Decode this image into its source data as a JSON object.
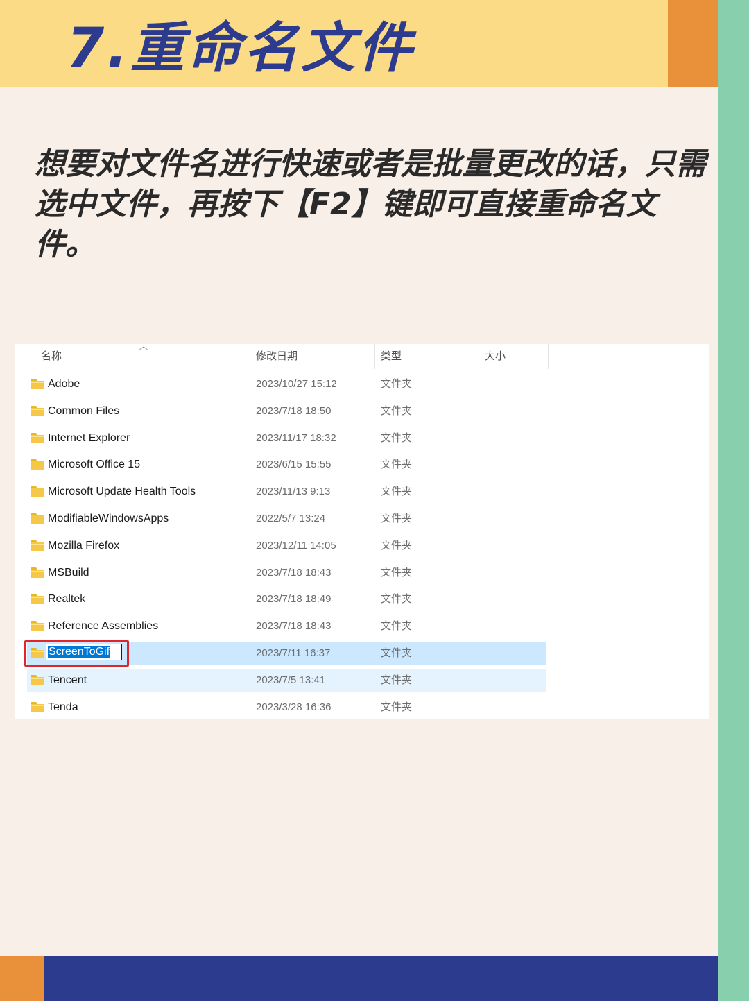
{
  "page": {
    "title": "7.重命名文件",
    "intro": "想要对文件名进行快速或者是批量更改的话，只需选中文件，再按下【F2】键即可直接重命名文件。"
  },
  "explorer": {
    "columns": {
      "name": "名称",
      "modified": "修改日期",
      "type": "类型",
      "size": "大小"
    },
    "rows": [
      {
        "name": "Adobe",
        "modified": "2023/10/27 15:12",
        "type": "文件夹"
      },
      {
        "name": "Common Files",
        "modified": "2023/7/18 18:50",
        "type": "文件夹"
      },
      {
        "name": "Internet Explorer",
        "modified": "2023/11/17 18:32",
        "type": "文件夹"
      },
      {
        "name": "Microsoft Office 15",
        "modified": "2023/6/15 15:55",
        "type": "文件夹"
      },
      {
        "name": "Microsoft Update Health Tools",
        "modified": "2023/11/13 9:13",
        "type": "文件夹"
      },
      {
        "name": "ModifiableWindowsApps",
        "modified": "2022/5/7 13:24",
        "type": "文件夹"
      },
      {
        "name": "Mozilla Firefox",
        "modified": "2023/12/11 14:05",
        "type": "文件夹"
      },
      {
        "name": "MSBuild",
        "modified": "2023/7/18 18:43",
        "type": "文件夹"
      },
      {
        "name": "Realtek",
        "modified": "2023/7/18 18:49",
        "type": "文件夹"
      },
      {
        "name": "Reference Assemblies",
        "modified": "2023/7/18 18:43",
        "type": "文件夹"
      },
      {
        "name": "ScreenToGif",
        "modified": "2023/7/11 16:37",
        "type": "文件夹"
      },
      {
        "name": "Tencent",
        "modified": "2023/7/5 13:41",
        "type": "文件夹"
      },
      {
        "name": "Tenda",
        "modified": "2023/3/28 16:36",
        "type": "文件夹"
      }
    ],
    "renaming_row": "ScreenToGif",
    "hovered_row": "Tencent",
    "icon": "folder-icon"
  },
  "colors": {
    "header_band": "#fcdb86",
    "accent_orange": "#e8913a",
    "side_green": "#88cfae",
    "navy": "#2c3b8e",
    "background": "#f8efe8",
    "selection": "#cce8ff",
    "hover": "#e5f3ff",
    "highlight_frame": "#e0262b"
  }
}
